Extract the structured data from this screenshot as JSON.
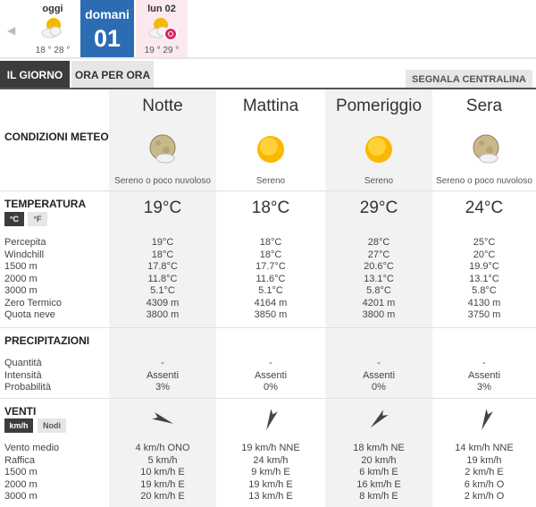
{
  "days": {
    "prev_arrow": "◀",
    "oggi": {
      "name": "oggi",
      "temps": "18 ° 28 °",
      "icon": "sun-cloud-icon"
    },
    "selected": {
      "name": "domani",
      "num": "01"
    },
    "lun": {
      "name": "lun 02",
      "temps": "19 ° 29 °",
      "icon": "sun-cloud-icon",
      "alert_icon": "alert-icon"
    }
  },
  "tabs": {
    "giorno": "IL GIORNO",
    "ora": "ORA PER ORA",
    "segnala": "SEGNALA CENTRALINA"
  },
  "sections": {
    "condizioni": "CONDIZIONI METEO",
    "temperatura": "TEMPERATURA",
    "precipitazioni": "PRECIPITAZIONI",
    "venti": "VENTI"
  },
  "units": {
    "celsius": "°C",
    "fahrenheit": "°F",
    "kmh": "km/h",
    "nodi": "Nodi"
  },
  "slots": [
    {
      "name": "Notte",
      "icon": "moon-cloud-icon",
      "desc": "Sereno o poco nuvoloso",
      "temp": "19°C"
    },
    {
      "name": "Mattina",
      "icon": "sun-icon",
      "desc": "Sereno",
      "temp": "18°C"
    },
    {
      "name": "Pomeriggio",
      "icon": "sun-icon",
      "desc": "Sereno",
      "temp": "29°C"
    },
    {
      "name": "Sera",
      "icon": "moon-cloud-icon",
      "desc": "Sereno o poco nuvoloso",
      "temp": "24°C"
    }
  ],
  "temp_labels": [
    "Percepita",
    "Windchill",
    "1500 m",
    "2000 m",
    "3000 m",
    "Zero Termico",
    "Quota neve"
  ],
  "temp_values": [
    [
      "19°C",
      "18°C",
      "17.8°C",
      "11.8°C",
      "5.1°C",
      "4309 m",
      "3800 m"
    ],
    [
      "18°C",
      "18°C",
      "17.7°C",
      "11.6°C",
      "5.1°C",
      "4164 m",
      "3850 m"
    ],
    [
      "28°C",
      "27°C",
      "20.6°C",
      "13.1°C",
      "5.8°C",
      "4201 m",
      "3800 m"
    ],
    [
      "25°C",
      "20°C",
      "19.9°C",
      "13.1°C",
      "5.8°C",
      "4130 m",
      "3750 m"
    ]
  ],
  "prec_labels": [
    "Quantità",
    "Intensità",
    "Probabilità"
  ],
  "prec_values": [
    [
      "-",
      "Assenti",
      "3%"
    ],
    [
      "-",
      "Assenti",
      "0%"
    ],
    [
      "-",
      "Assenti",
      "0%"
    ],
    [
      "-",
      "Assenti",
      "3%"
    ]
  ],
  "wind_labels": [
    "Vento medio",
    "Raffica",
    "1500 m",
    "2000 m",
    "3000 m"
  ],
  "wind_values": [
    [
      "4 km/h  ONO",
      "5 km/h",
      "10 km/h E",
      "19 km/h E",
      "20 km/h E"
    ],
    [
      "19 km/h NNE",
      "24 km/h",
      "9 km/h E",
      "19 km/h E",
      "13 km/h E"
    ],
    [
      "18 km/h NE",
      "20 km/h",
      "6 km/h E",
      "16 km/h E",
      "8 km/h E"
    ],
    [
      "14 km/h NNE",
      "19 km/h",
      "2 km/h E",
      "6 km/h O",
      "2 km/h O"
    ]
  ],
  "wind_arrows": [
    {
      "direction": "ONO",
      "icon": "wind-arrow-icon"
    },
    {
      "direction": "NNE",
      "icon": "wind-arrow-icon"
    },
    {
      "direction": "NE",
      "icon": "wind-arrow-icon"
    },
    {
      "direction": "NNE",
      "icon": "wind-arrow-icon"
    }
  ]
}
